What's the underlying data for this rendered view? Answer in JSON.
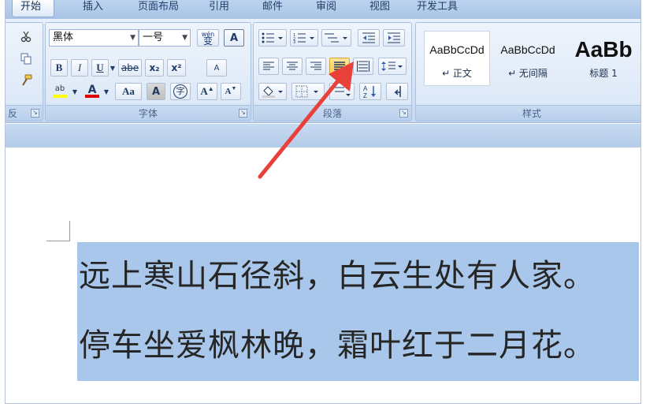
{
  "tabs": [
    {
      "label": "开始",
      "active": true
    },
    {
      "label": "插入"
    },
    {
      "label": "页面布局"
    },
    {
      "label": "引用"
    },
    {
      "label": "邮件"
    },
    {
      "label": "审阅"
    },
    {
      "label": "视图"
    },
    {
      "label": "开发工具"
    }
  ],
  "clipboard": {
    "label_fragment": "反",
    "icons": [
      "scissors-icon",
      "copy-icon",
      "format-painter-icon"
    ]
  },
  "font": {
    "group_label": "字体",
    "font_name": "黑体",
    "font_size": "一号",
    "phonetic_guide": "wén",
    "phonetic_char": "变",
    "char_border": "A",
    "bold": "B",
    "italic": "I",
    "underline": "U",
    "strikethrough": "abe",
    "subscript": "x₂",
    "superscript": "x²",
    "clear_format": "A",
    "highlight": "ab",
    "font_color": "A",
    "change_case": "Aa",
    "char_shading": "A",
    "enclose_char": "字",
    "grow_font": "A",
    "shrink_font": "A"
  },
  "paragraph": {
    "group_label": "段落",
    "active_button": "distributed-align"
  },
  "styles": {
    "group_label": "样式",
    "tiles": [
      {
        "sample": "AaBbCcDd",
        "name": "↵ 正文"
      },
      {
        "sample": "AaBbCcDd",
        "name": "↵ 无间隔"
      },
      {
        "sample": "AaBb",
        "name": "标题 1"
      }
    ]
  },
  "document": {
    "lines": [
      "远上寒山石径斜，白云生处有人家。",
      "停车坐爱枫林晚，霜叶红于二月花。"
    ]
  },
  "colors": {
    "selection": "#a9c7ea",
    "annotation_arrow": "#e8413a",
    "highlight_yellow": "#ffff00",
    "font_red": "#e00000",
    "active_button": "#ffc94a"
  }
}
